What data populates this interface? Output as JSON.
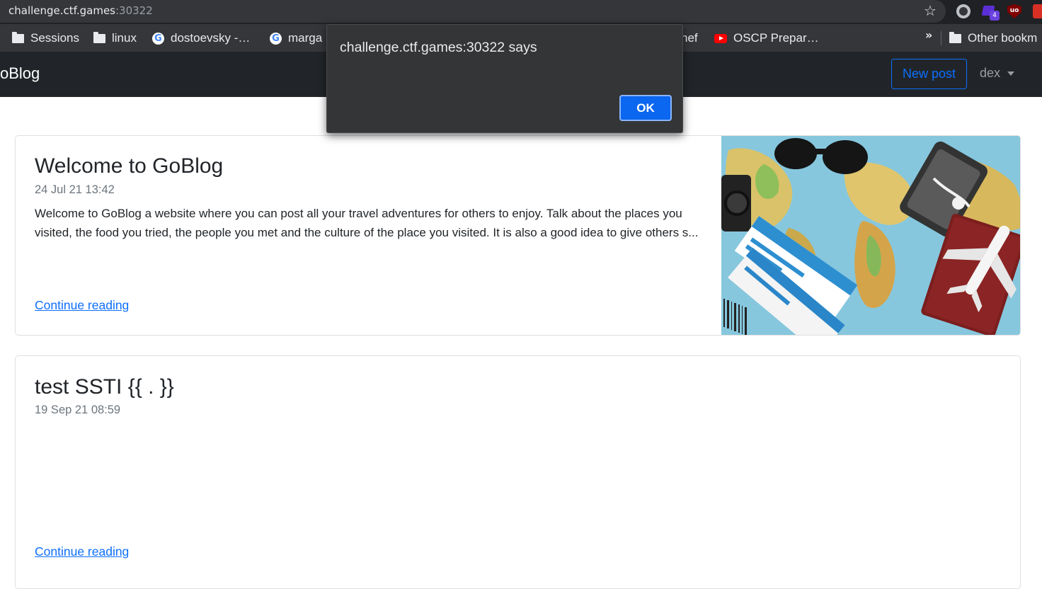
{
  "browser": {
    "url_host": "challenge.ctf.games",
    "url_port": ":30322",
    "bookmarks": [
      {
        "label": "Sessions",
        "icon": "folder-icon"
      },
      {
        "label": "linux",
        "icon": "folder-icon"
      },
      {
        "label": "dostoevsky -…",
        "icon": "google-icon"
      },
      {
        "label": "marga",
        "icon": "google-icon"
      },
      {
        "label": "hef",
        "icon": "none"
      },
      {
        "label": "OSCP Prepar…",
        "icon": "youtube-icon"
      }
    ],
    "overflow_label": "»",
    "other_bookmarks": "Other bookm",
    "extension_badge": "4",
    "ublock_label": "uo"
  },
  "navbar": {
    "brand": "oBlog",
    "new_post": "New post",
    "user": "dex"
  },
  "posts": [
    {
      "title": "Welcome to GoBlog",
      "date": "24 Jul 21 13:42",
      "excerpt": "Welcome to GoBlog a website where you can post all your travel adventures for others to enjoy. Talk about the places you visited, the food you tried, the people you met and the culture of the place you visited. It is also a good idea to give others s...",
      "link": "Continue reading"
    },
    {
      "title": "test SSTI {{ . }}",
      "date": "19 Sep 21 08:59",
      "excerpt": "",
      "link": "Continue reading"
    }
  ],
  "alert": {
    "title": "challenge.ctf.games:30322 says",
    "ok": "OK"
  },
  "colors": {
    "accent": "#0d6efd",
    "navbar_bg": "#212529",
    "chrome_bg": "#35363a",
    "dialog_bg": "#343536"
  }
}
